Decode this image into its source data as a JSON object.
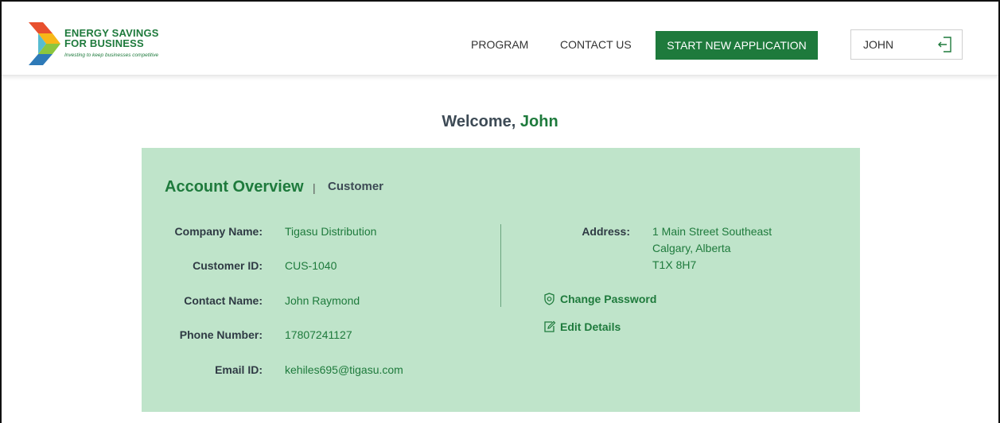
{
  "header": {
    "logo": {
      "line1": "ENERGY SAVINGS",
      "line2": "FOR BUSINESS",
      "tagline": "Investing to keep businesses competitive"
    },
    "nav": {
      "program": "PROGRAM",
      "contact": "CONTACT US"
    },
    "start_button": "START NEW APPLICATION",
    "user": {
      "name": "JOHN",
      "logout_icon": "logout-icon"
    }
  },
  "welcome": {
    "prefix": "Welcome, ",
    "name": "John"
  },
  "account": {
    "title": "Account Overview",
    "separator": "|",
    "role": "Customer",
    "fields": [
      {
        "label": "Company Name:",
        "value": "Tigasu Distribution"
      },
      {
        "label": "Customer ID:",
        "value": "CUS-1040"
      },
      {
        "label": "Contact Name:",
        "value": "John Raymond"
      },
      {
        "label": "Phone Number:",
        "value": "17807241127"
      },
      {
        "label": "Email ID:",
        "value": "kehiles695@tigasu.com"
      }
    ],
    "address": {
      "label": "Address:",
      "lines": [
        "1 Main Street Southeast",
        "Calgary, Alberta",
        "T1X 8H7"
      ]
    },
    "actions": {
      "change_password": "Change Password",
      "edit_details": "Edit Details"
    }
  },
  "colors": {
    "brand_green": "#1e7a3c",
    "panel_bg": "#bfe4ca"
  }
}
